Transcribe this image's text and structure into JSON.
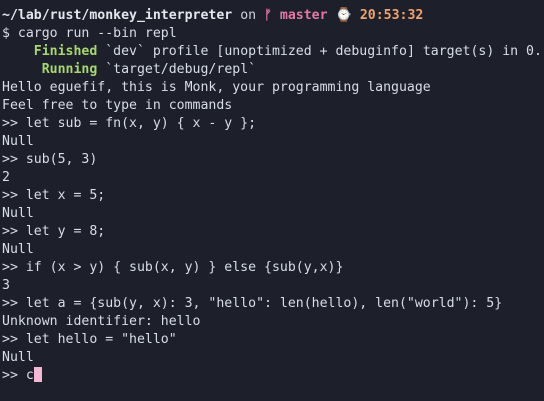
{
  "prompt": {
    "path": "~/lab/rust/monkey_interpreter",
    "on": " on ",
    "branch_icon": "ᚠ",
    "branch": "master",
    "clock_icon": "⌚",
    "time": "20:53:32"
  },
  "command": "$ cargo run --bin repl",
  "build": {
    "finished_status": "Finished",
    "finished_rest": " `dev` profile [unoptimized + debuginfo] target(s) in 0.",
    "running_status": "Running",
    "running_rest": " `target/debug/repl`"
  },
  "output": [
    "Hello eguefif, this is Monk, your programming language",
    "Feel free to type in commands",
    ">> let sub = fn(x, y) { x - y };",
    "Null",
    ">> sub(5, 3)",
    "2",
    ">> let x = 5;",
    "Null",
    ">> let y = 8;",
    "Null",
    ">> if (x > y) { sub(x, y) } else {sub(y,x)}",
    "3",
    ">> let a = {sub(y, x): 3, \"hello\": len(hello), len(\"world\"): 5}",
    "Unknown identifier: hello",
    ">> let hello = \"hello\"",
    "Null"
  ],
  "input": {
    "prompt": ">> ",
    "value": "c"
  }
}
